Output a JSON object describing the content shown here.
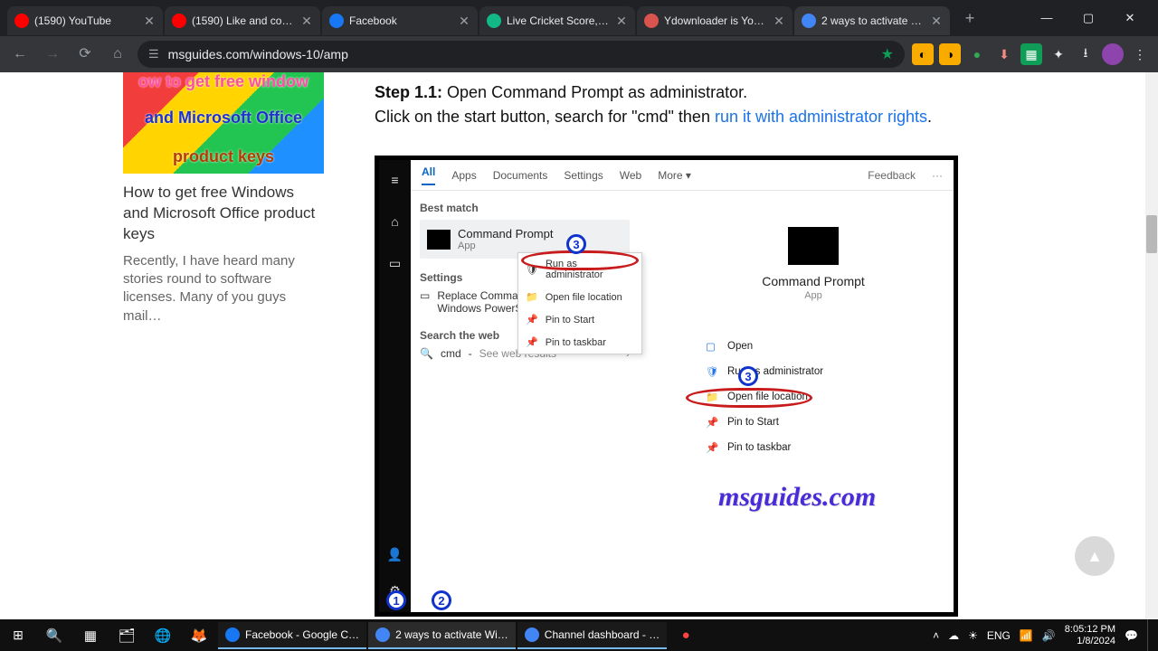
{
  "browser": {
    "tabs": [
      {
        "title": "(1590) YouTube",
        "icon_color": "#ff0000"
      },
      {
        "title": "(1590) Like and com…",
        "icon_color": "#ff0000"
      },
      {
        "title": "Facebook",
        "icon_color": "#1877f2"
      },
      {
        "title": "Live Cricket Score, Sc…",
        "icon_color": "#12b886"
      },
      {
        "title": "Ydownloader is Your…",
        "icon_color": "#d9534f"
      },
      {
        "title": "2 ways to activate Wi…",
        "icon_color": "#4285f4",
        "active": true
      }
    ],
    "new_tab": "+",
    "win_minimize": "—",
    "win_maximize": "▢",
    "win_close": "✕",
    "url": "msguides.com/windows-10/amp"
  },
  "sidebar": {
    "thumb_line1": "ow to get free window",
    "thumb_line2": "and Microsoft Office",
    "thumb_line3": "product keys",
    "title": "How to get free Windows and Microsoft Office product keys",
    "desc": "Recently, I have heard many stories round to software licenses. Many of you guys mail…"
  },
  "article": {
    "step_label": "Step 1.1:",
    "step_text": " Open Command Prompt as administrator.",
    "line2_a": "Click on the start button, search for \"cmd\" then ",
    "line2_link": "run it with administrator rights",
    "line2_b": "."
  },
  "figure": {
    "tabs": {
      "all": "All",
      "apps": "Apps",
      "documents": "Documents",
      "settings": "Settings",
      "web": "Web",
      "more": "More ▾",
      "feedback": "Feedback",
      "dots": "···"
    },
    "best_match": "Best match",
    "cmd_name": "Command Prompt",
    "cmd_kind": "App",
    "settings_label": "Settings",
    "setting_item": "Replace Command Prompt with Windows PowerShell…",
    "search_web_label": "Search the web",
    "cmd_query": "cmd",
    "see_web": "See web results",
    "ctx": {
      "run_admin": "Run as administrator",
      "open_loc": "Open file location",
      "pin_start": "Pin to Start",
      "pin_task": "Pin to taskbar"
    },
    "right": {
      "open": "Open",
      "run_admin": "Run as administrator",
      "open_loc": "Open file location",
      "pin_start": "Pin to Start",
      "pin_task": "Pin to taskbar"
    },
    "watermark": "msguides.com",
    "markers": {
      "one": "1",
      "two": "2",
      "three": "3"
    }
  },
  "scrolltop_glyph": "▲",
  "taskbar": {
    "apps": [
      {
        "label": "Facebook - Google C…",
        "icon": "#1877f2"
      },
      {
        "label": "2 ways to activate Wi…",
        "icon": "#4285f4",
        "active": true
      },
      {
        "label": "Channel dashboard - …",
        "icon": "#4285f4"
      }
    ],
    "recording": "●",
    "tray": {
      "chev": "˄",
      "lang": "ENG",
      "time": "8:05:12 PM",
      "date": "1/8/2024"
    }
  }
}
